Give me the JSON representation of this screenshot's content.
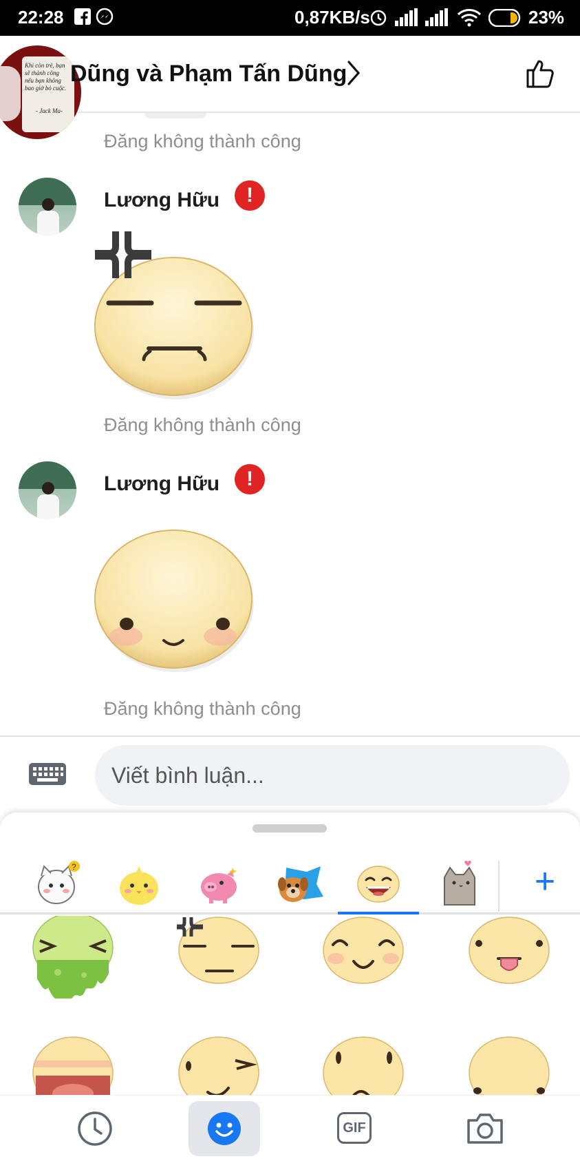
{
  "status_bar": {
    "time": "22:28",
    "network_speed": "0,87KB/s",
    "battery": "23%"
  },
  "header": {
    "title": "Dũng và Phạm Tấn Dũng"
  },
  "group_avatar": {
    "quote_lines": [
      "Khi còn trẻ, bạn",
      "sẽ thành công",
      "nếu bạn không",
      "bao giờ bỏ cuộc."
    ],
    "quote_author": "- Jack Ma-"
  },
  "messages": [
    {
      "status": "Đăng không thành công"
    },
    {
      "sender": "Lương Hữu",
      "sticker": "angry-face-sticker",
      "status": "Đăng không thành công"
    },
    {
      "sender": "Lương Hữu",
      "sticker": "shy-face-sticker",
      "status": "Đăng không thành công"
    }
  ],
  "composer": {
    "placeholder": "Viết bình luận..."
  },
  "sticker_tabs": [
    {
      "name": "cat-question-sticker-pack"
    },
    {
      "name": "chick-sticker-pack"
    },
    {
      "name": "pig-sticker-pack"
    },
    {
      "name": "dog-sticker-pack"
    },
    {
      "name": "smiley-face-sticker-pack",
      "selected": true
    },
    {
      "name": "pusheen-cat-sticker-pack"
    }
  ],
  "accent_color": "#1877f2",
  "error_color": "#e02323",
  "bottom_bar": {
    "gif_label": "GIF"
  }
}
